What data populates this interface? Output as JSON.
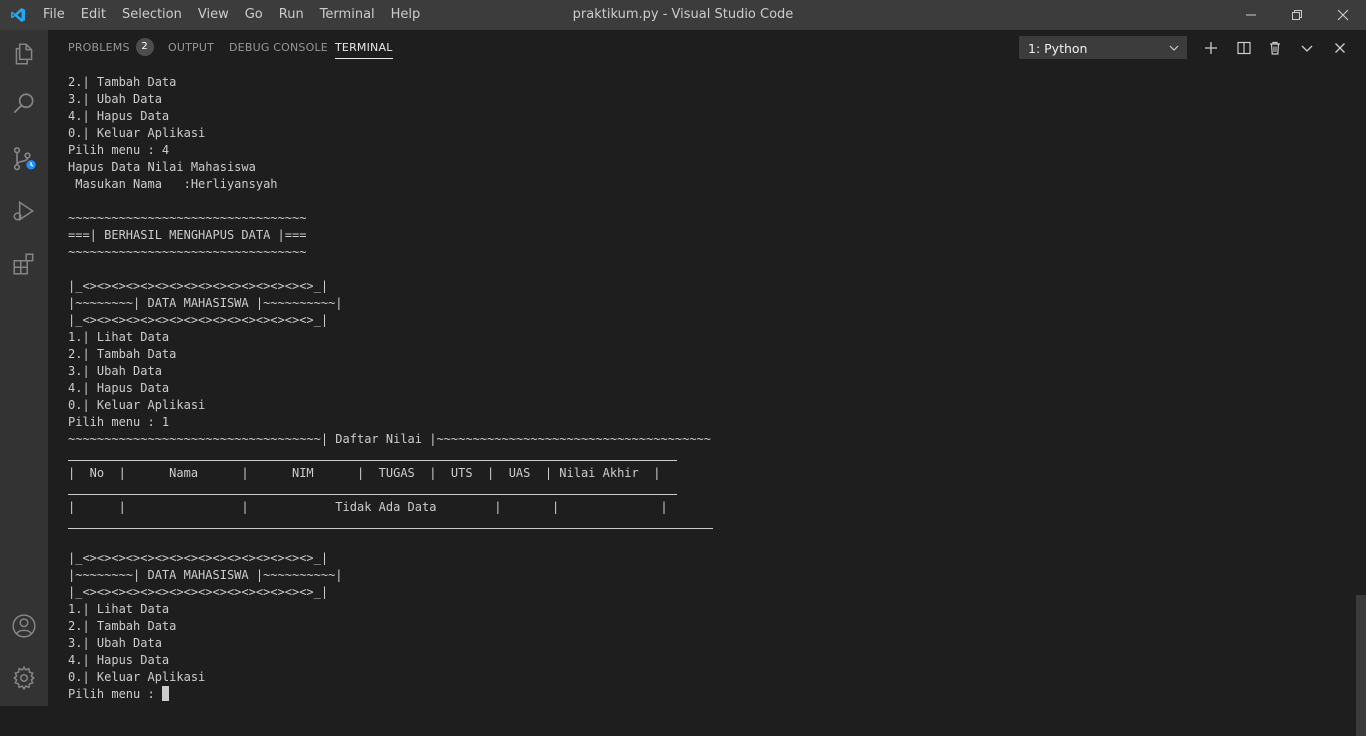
{
  "titlebar": {
    "menu": [
      "File",
      "Edit",
      "Selection",
      "View",
      "Go",
      "Run",
      "Terminal",
      "Help"
    ],
    "title": "praktikum.py - Visual Studio Code"
  },
  "activity_icons": [
    "explorer-icon",
    "search-icon",
    "source-control-icon",
    "run-debug-icon",
    "extensions-icon",
    "account-icon",
    "settings-gear-icon"
  ],
  "panel": {
    "tabs": {
      "problems": "PROBLEMS",
      "problems_count": "2",
      "output": "OUTPUT",
      "debug_console": "DEBUG CONSOLE",
      "terminal": "TERMINAL"
    },
    "terminal_select": "1: Python"
  },
  "terminal": {
    "lines": [
      "2.| Tambah Data",
      "3.| Ubah Data",
      "4.| Hapus Data",
      "0.| Keluar Aplikasi",
      "Pilih menu : 4",
      "Hapus Data Nilai Mahasiswa",
      " Masukan Nama   :Herliyansyah",
      "",
      "~~~~~~~~~~~~~~~~~~~~~~~~~~~~~~~~~",
      "===| BERHASIL MENGHAPUS DATA |===",
      "~~~~~~~~~~~~~~~~~~~~~~~~~~~~~~~~~",
      "",
      "|_<><><><><><><><><><><><><><><><>_|",
      "|~~~~~~~~| DATA MAHASISWA |~~~~~~~~~~|",
      "|_<><><><><><><><><><><><><><><><>_|",
      "1.| Lihat Data",
      "2.| Tambah Data",
      "3.| Ubah Data",
      "4.| Hapus Data",
      "0.| Keluar Aplikasi",
      "Pilih menu : 1",
      "~~~~~~~~~~~~~~~~~~~~~~~~~~~~~~~~~~~| Daftar Nilai |~~~~~~~~~~~~~~~~~~~~~~~~~~~~~~~~~~~~~~",
      "",
      "|  No  |      Nama      |      NIM      |  TUGAS  |  UTS  |  UAS  | Nilai Akhir  |",
      "",
      "|      |                |            Tidak Ada Data        |       |              |",
      "",
      "",
      "|_<><><><><><><><><><><><><><><><>_|",
      "|~~~~~~~~| DATA MAHASISWA |~~~~~~~~~~|",
      "|_<><><><><><><><><><><><><><><><>_|",
      "1.| Lihat Data",
      "2.| Tambah Data",
      "3.| Ubah Data",
      "4.| Hapus Data",
      "0.| Keluar Aplikasi"
    ],
    "prompt": "Pilih menu : "
  }
}
